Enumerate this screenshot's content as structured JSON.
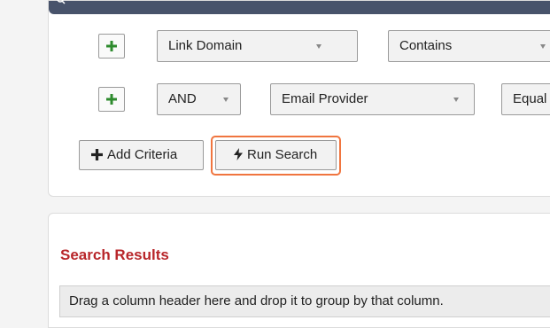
{
  "criteria": {
    "row1": {
      "field": "Link Domain",
      "operator": "Contains"
    },
    "row2": {
      "logic": "AND",
      "field": "Email Provider",
      "operator": "Equal"
    }
  },
  "actions": {
    "add_criteria_label": "Add Criteria",
    "run_search_label": "Run Search"
  },
  "results": {
    "title": "Search Results",
    "group_hint": "Drag a column header here and drop it to group by that column."
  },
  "colors": {
    "header_bar": "#48536b",
    "plus_green": "#2e8b2e",
    "highlight": "#f0753f",
    "results_title": "#b8262a"
  },
  "icons": [
    "search-icon",
    "plus-icon",
    "plus-icon",
    "bolt-icon"
  ]
}
